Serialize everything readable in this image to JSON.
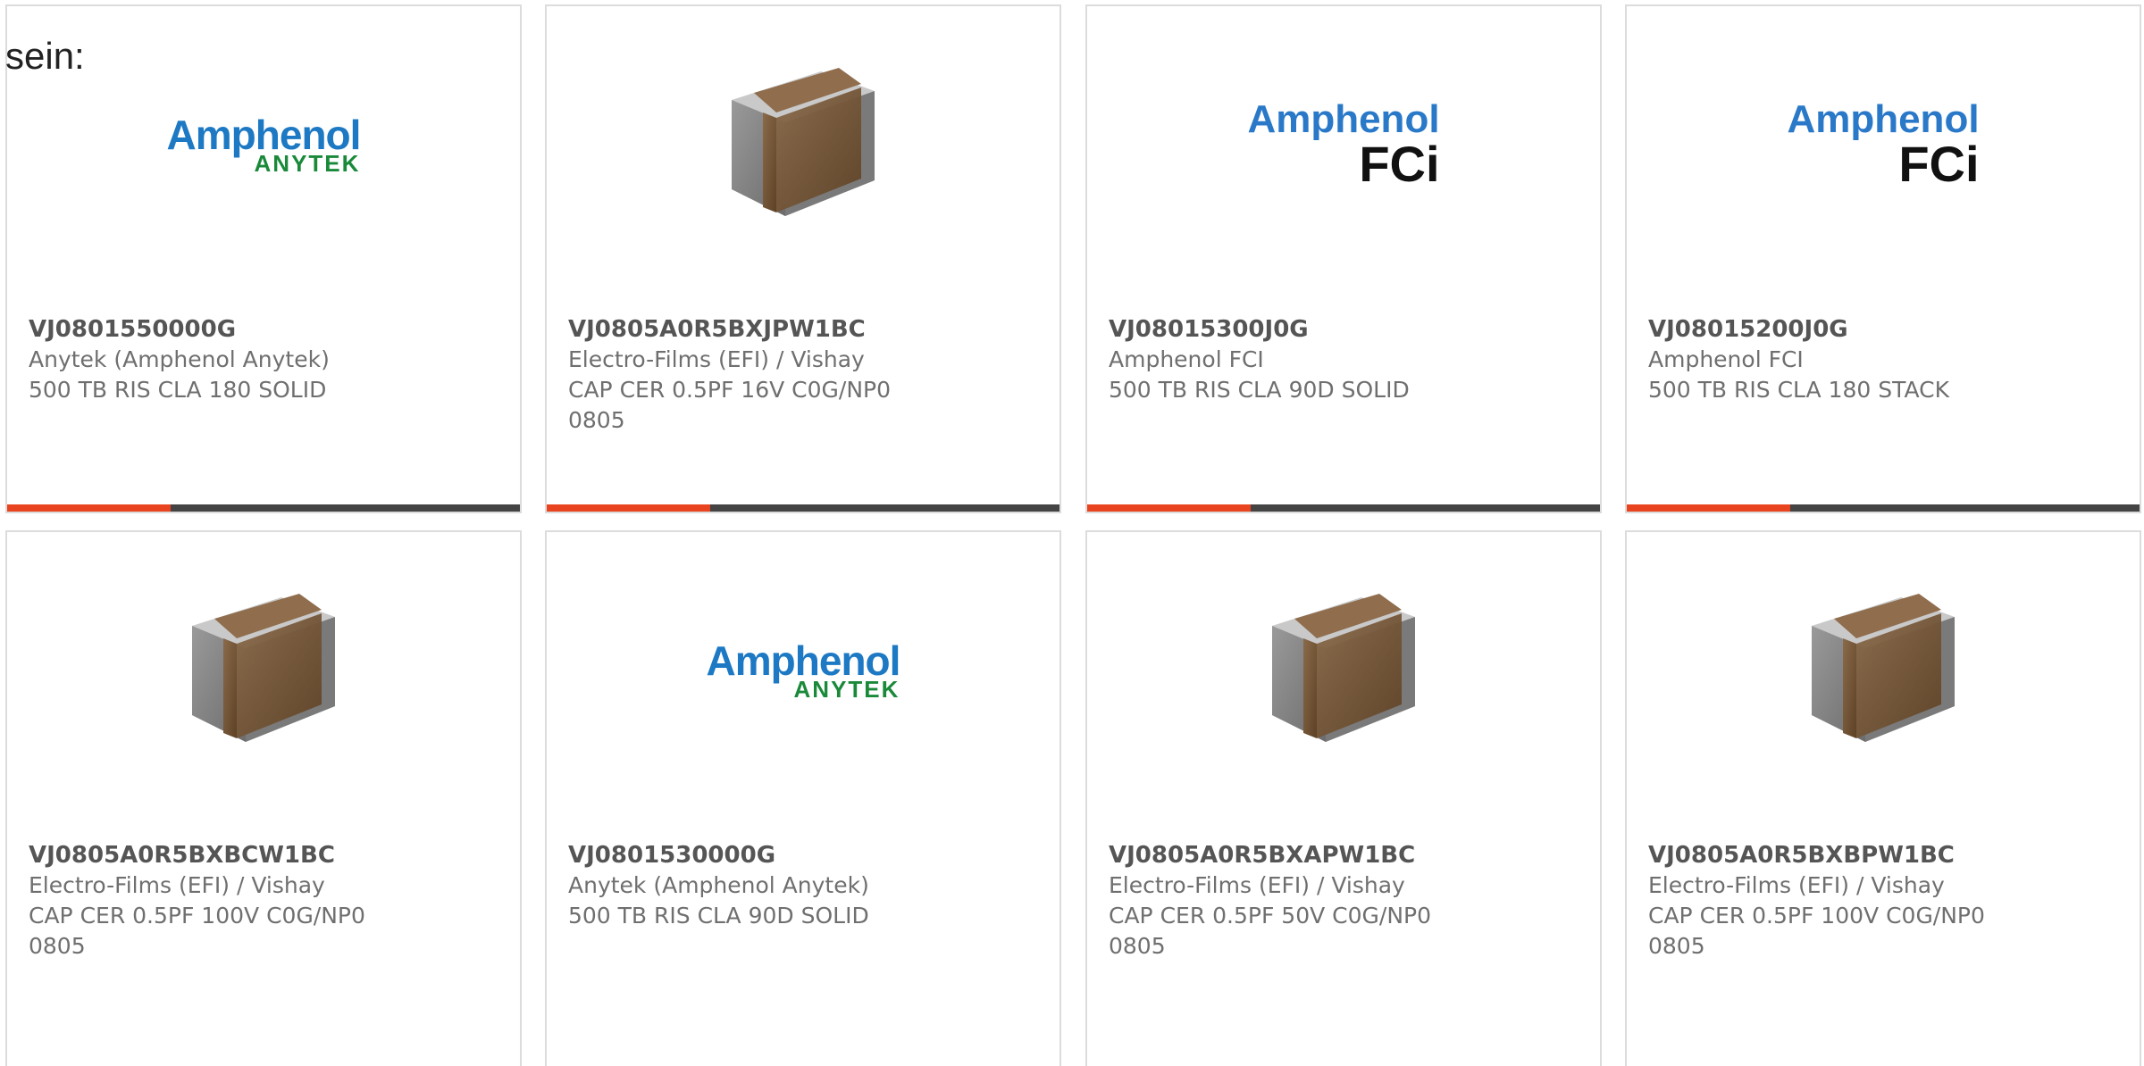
{
  "lead_text": "sein:",
  "colors": {
    "accent": "#e8441f",
    "bar": "#444444",
    "border": "#dcdcdc"
  },
  "cards": [
    {
      "part": "VJ0801550000G",
      "manufacturer": "Anytek (Amphenol Anytek)",
      "description": "500 TB RIS CLA 180 SOLID",
      "image": "amphenol-anytek-logo",
      "logo_main": "Amphenol",
      "logo_sub": "ANYTEK"
    },
    {
      "part": "VJ0805A0R5BXJPW1BC",
      "manufacturer": "Electro-Films (EFI) / Vishay",
      "description": "CAP CER 0.5PF 16V C0G/NP0 0805",
      "image": "ceramic-capacitor-icon"
    },
    {
      "part": "VJ08015300J0G",
      "manufacturer": "Amphenol FCI",
      "description": "500 TB RIS CLA 90D SOLID",
      "image": "amphenol-fci-logo",
      "logo_main": "Amphenol",
      "logo_sub": "FCi"
    },
    {
      "part": "VJ08015200J0G",
      "manufacturer": "Amphenol FCI",
      "description": "500 TB RIS CLA 180 STACK",
      "image": "amphenol-fci-logo",
      "logo_main": "Amphenol",
      "logo_sub": "FCi"
    },
    {
      "part": "VJ0805A0R5BXBCW1BC",
      "manufacturer": "Electro-Films (EFI) / Vishay",
      "description": "CAP CER 0.5PF 100V C0G/NP0 0805",
      "image": "ceramic-capacitor-icon"
    },
    {
      "part": "VJ0801530000G",
      "manufacturer": "Anytek (Amphenol Anytek)",
      "description": "500 TB RIS CLA 90D SOLID",
      "image": "amphenol-anytek-logo",
      "logo_main": "Amphenol",
      "logo_sub": "ANYTEK"
    },
    {
      "part": "VJ0805A0R5BXAPW1BC",
      "manufacturer": "Electro-Films (EFI) / Vishay",
      "description": "CAP CER 0.5PF 50V C0G/NP0 0805",
      "image": "ceramic-capacitor-icon"
    },
    {
      "part": "VJ0805A0R5BXBPW1BC",
      "manufacturer": "Electro-Films (EFI) / Vishay",
      "description": "CAP CER 0.5PF 100V C0G/NP0 0805",
      "image": "ceramic-capacitor-icon"
    }
  ]
}
